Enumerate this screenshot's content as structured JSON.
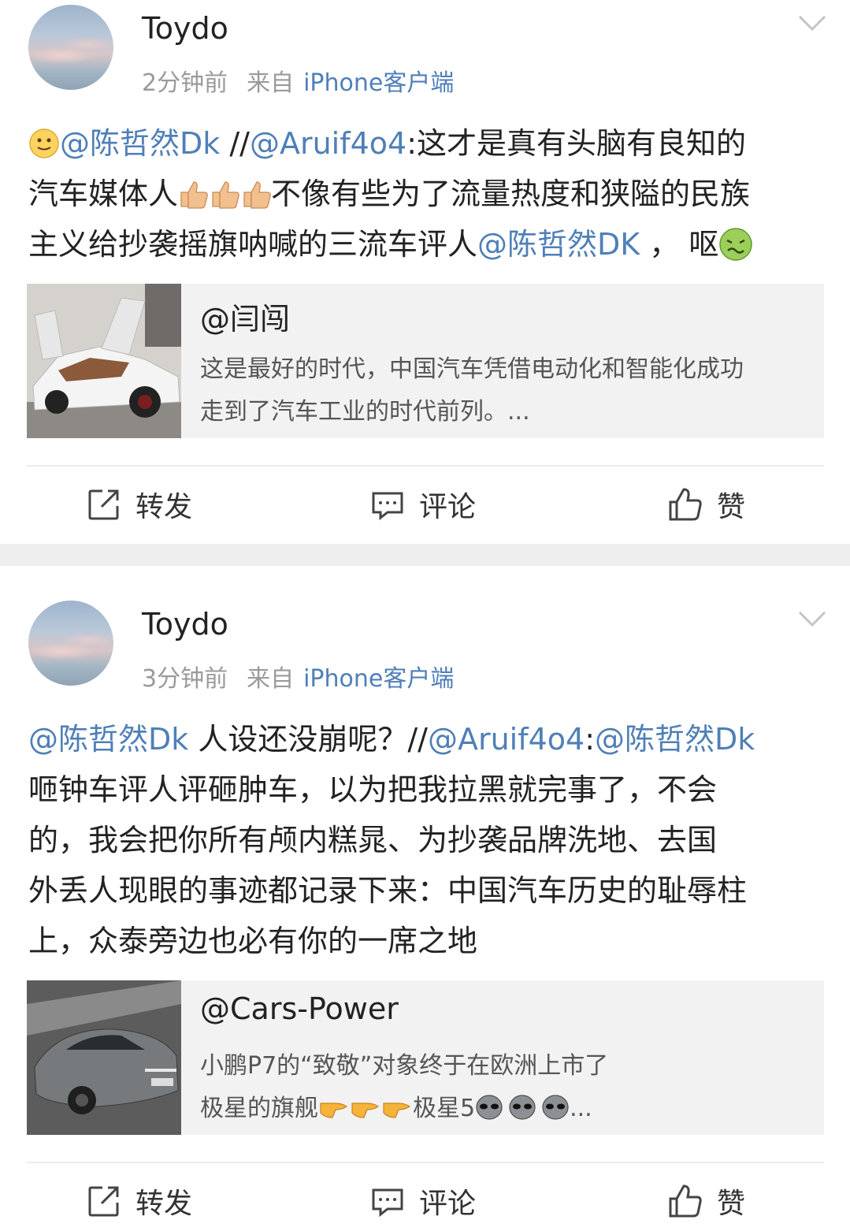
{
  "posts": [
    {
      "author": "Toydo",
      "time": "2分钟前",
      "source_prefix": "来自",
      "client": "iPhone客户端",
      "content": {
        "line1": {
          "mention1": "@陈哲然Dk",
          "sep": " //",
          "mention2": "@Aruif4o4",
          "text": ":这才是真有头脑有良知的"
        },
        "line2": {
          "text_a": "汽车媒体人",
          "text_b": "不像有些为了流量热度和狭隘的民族"
        },
        "line3": {
          "text_a": "主义给抄袭摇旗呐喊的三流车评人",
          "mention": "@陈哲然DK",
          "text_b": " ， 呕"
        }
      },
      "quote": {
        "name": "@闫闯",
        "line1": "这是最好的时代，中国汽车凭借电动化和智能化成功",
        "line2": "走到了汽车工业的时代前列。..."
      },
      "actions": {
        "repost": "转发",
        "comment": "评论",
        "like": "赞"
      }
    },
    {
      "author": "Toydo",
      "time": "3分钟前",
      "source_prefix": "来自",
      "client": "iPhone客户端",
      "content": {
        "line1": {
          "mention1": "@陈哲然Dk",
          "text": " 人设还没崩呢？//",
          "mention2": "@Aruif4o4",
          "colon": ":",
          "mention3": "@陈哲然Dk"
        },
        "line2": "咂钟车评人评砸肿车，以为把我拉黑就完事了，不会",
        "line3": "的，我会把你所有颅内糕晁、为抄袭品牌洗地、去国",
        "line4": "外丢人现眼的事迹都记录下来：中国汽车历史的耻辱柱",
        "line5": "上，众泰旁边也必有你的一席之地"
      },
      "quote": {
        "name": "@Cars-Power",
        "line1": "小鹏P7的“致敬”对象终于在欧洲上市了",
        "line2_a": "极星的旗舰",
        "line2_b": "极星5",
        "line2_c": "..."
      },
      "actions": {
        "repost": "转发",
        "comment": "评论",
        "like": "赞"
      }
    }
  ],
  "icons": {
    "repost": "repost-icon",
    "comment": "comment-icon",
    "like": "like-icon",
    "more": "chevron-down-icon"
  },
  "colors": {
    "link": "#4f7fb8",
    "meta": "#9a9a9a",
    "separator": "#eeeeee"
  }
}
